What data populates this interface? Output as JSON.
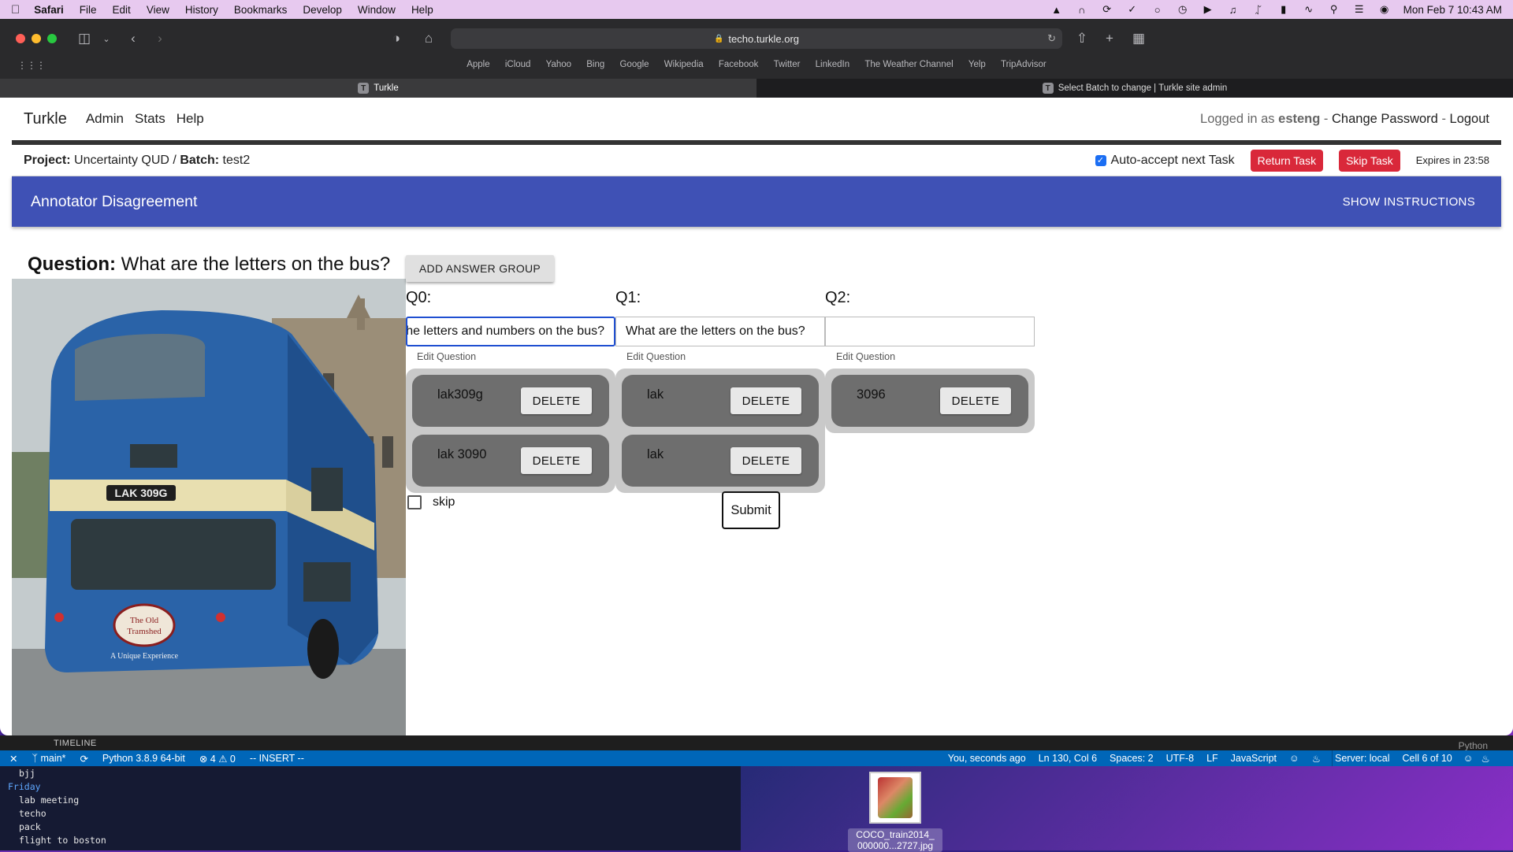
{
  "menubar": {
    "app": "Safari",
    "items": [
      "File",
      "Edit",
      "View",
      "History",
      "Bookmarks",
      "Develop",
      "Window",
      "Help"
    ],
    "clock": "Mon Feb 7  10:43 AM"
  },
  "browser": {
    "url": "techo.turkle.org",
    "favorites": [
      "Apple",
      "iCloud",
      "Yahoo",
      "Bing",
      "Google",
      "Wikipedia",
      "Facebook",
      "Twitter",
      "LinkedIn",
      "The Weather Channel",
      "Yelp",
      "TripAdvisor"
    ],
    "tabs": [
      {
        "label": "Turkle",
        "active": true
      },
      {
        "label": "Select Batch to change | Turkle site admin",
        "active": false
      }
    ]
  },
  "nav": {
    "brand": "Turkle",
    "links": [
      "Admin",
      "Stats",
      "Help"
    ],
    "logged_in_prefix": "Logged in as",
    "username": "esteng",
    "change_password": "Change Password",
    "logout": "Logout",
    "sep": "-"
  },
  "project": {
    "project_label": "Project:",
    "project_name": "Uncertainty QUD",
    "slash": "/",
    "batch_label": "Batch:",
    "batch_name": "test2",
    "auto_accept": "Auto-accept next Task",
    "return_task": "Return Task",
    "skip_task": "Skip Task",
    "expires": "Expires in 23:58"
  },
  "appbar": {
    "title": "Annotator Disagreement",
    "show_instructions": "SHOW INSTRUCTIONS"
  },
  "task": {
    "question_label": "Question:",
    "question_text": "What are the letters on the bus?",
    "add_group": "ADD ANSWER GROUP",
    "edit_question": "Edit Question",
    "columns": [
      {
        "label": "Q0:",
        "value": "What are the letters and numbers on the bus?",
        "answers": [
          {
            "text": "lak309g",
            "delete": "DELETE"
          },
          {
            "text": "lak 3090",
            "delete": "DELETE"
          }
        ]
      },
      {
        "label": "Q1:",
        "value": "What are the letters on the bus?",
        "answers": [
          {
            "text": "lak",
            "delete": "DELETE"
          },
          {
            "text": "lak",
            "delete": "DELETE"
          }
        ]
      },
      {
        "label": "Q2:",
        "value": "",
        "answers": [
          {
            "text": "3096",
            "delete": "DELETE"
          }
        ]
      }
    ],
    "skip": "skip",
    "submit": "Submit"
  },
  "image": {
    "plate": "LAK 309G",
    "sign_line1": "The Old",
    "sign_line2": "Tramshed",
    "sign_line3": "A Unique Experience"
  },
  "vscode": {
    "timeline": "TIMELINE",
    "python_label": "Python",
    "branch": "main*",
    "interpreter": "Python 3.8.9 64-bit",
    "problems": "⊗ 4 ⚠ 0",
    "mode": "-- INSERT --",
    "blame": "You, seconds ago",
    "position": "Ln 130, Col 6",
    "spaces": "Spaces: 2",
    "encoding": "UTF-8",
    "eol": "LF",
    "language": "JavaScript",
    "server": "Server: local",
    "cell": "Cell 6 of 10"
  },
  "terminal": {
    "lines": [
      "bjj",
      "Friday",
      "lab meeting",
      "techo",
      "pack",
      "flight to boston"
    ]
  },
  "desktop": {
    "file_line1": "COCO_train2014_",
    "file_line2": "000000...2727.jpg"
  },
  "colors": {
    "appbar": "#3f51b5",
    "danger": "#d9283a",
    "statusbar": "#0066b8"
  }
}
